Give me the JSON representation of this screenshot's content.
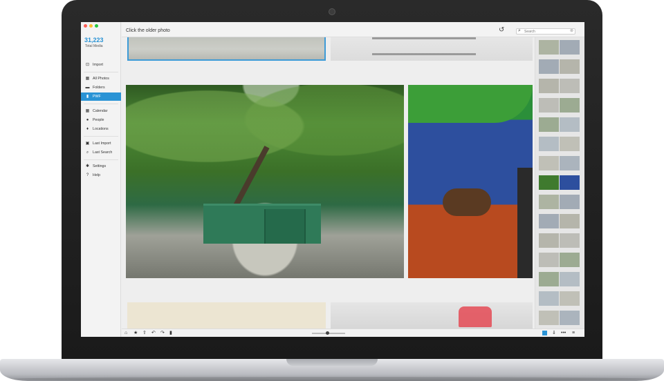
{
  "app": {
    "total_count": "31,223",
    "total_label": "Total Media",
    "accent_color": "#2a93d5"
  },
  "sidebar": {
    "items": [
      {
        "label": "Import",
        "icon": "import-icon"
      },
      {
        "label": "All Photos",
        "icon": "grid-icon"
      },
      {
        "label": "Folders",
        "icon": "folder-icon"
      },
      {
        "label": "PWF",
        "icon": "book-icon",
        "active": true
      },
      {
        "label": "Calendar",
        "icon": "calendar-icon"
      },
      {
        "label": "People",
        "icon": "person-icon"
      },
      {
        "label": "Locations",
        "icon": "location-pin-icon"
      },
      {
        "label": "Last Import",
        "icon": "last-import-icon"
      },
      {
        "label": "Last Search",
        "icon": "search-icon"
      },
      {
        "label": "Settings",
        "icon": "gear-icon"
      },
      {
        "label": "Help",
        "icon": "help-icon"
      }
    ]
  },
  "header": {
    "title": "Click the older photo",
    "search_placeholder": "Search"
  },
  "photos": {
    "main_left": "forest-gate-photo",
    "main_right": "person-green-scarf-photo"
  },
  "bottom_toolbar": {
    "tools": [
      "home-icon",
      "star-icon",
      "share-icon",
      "rotate-left-icon",
      "rotate-right-icon",
      "trash-icon"
    ],
    "zoom_level": 0.5
  }
}
